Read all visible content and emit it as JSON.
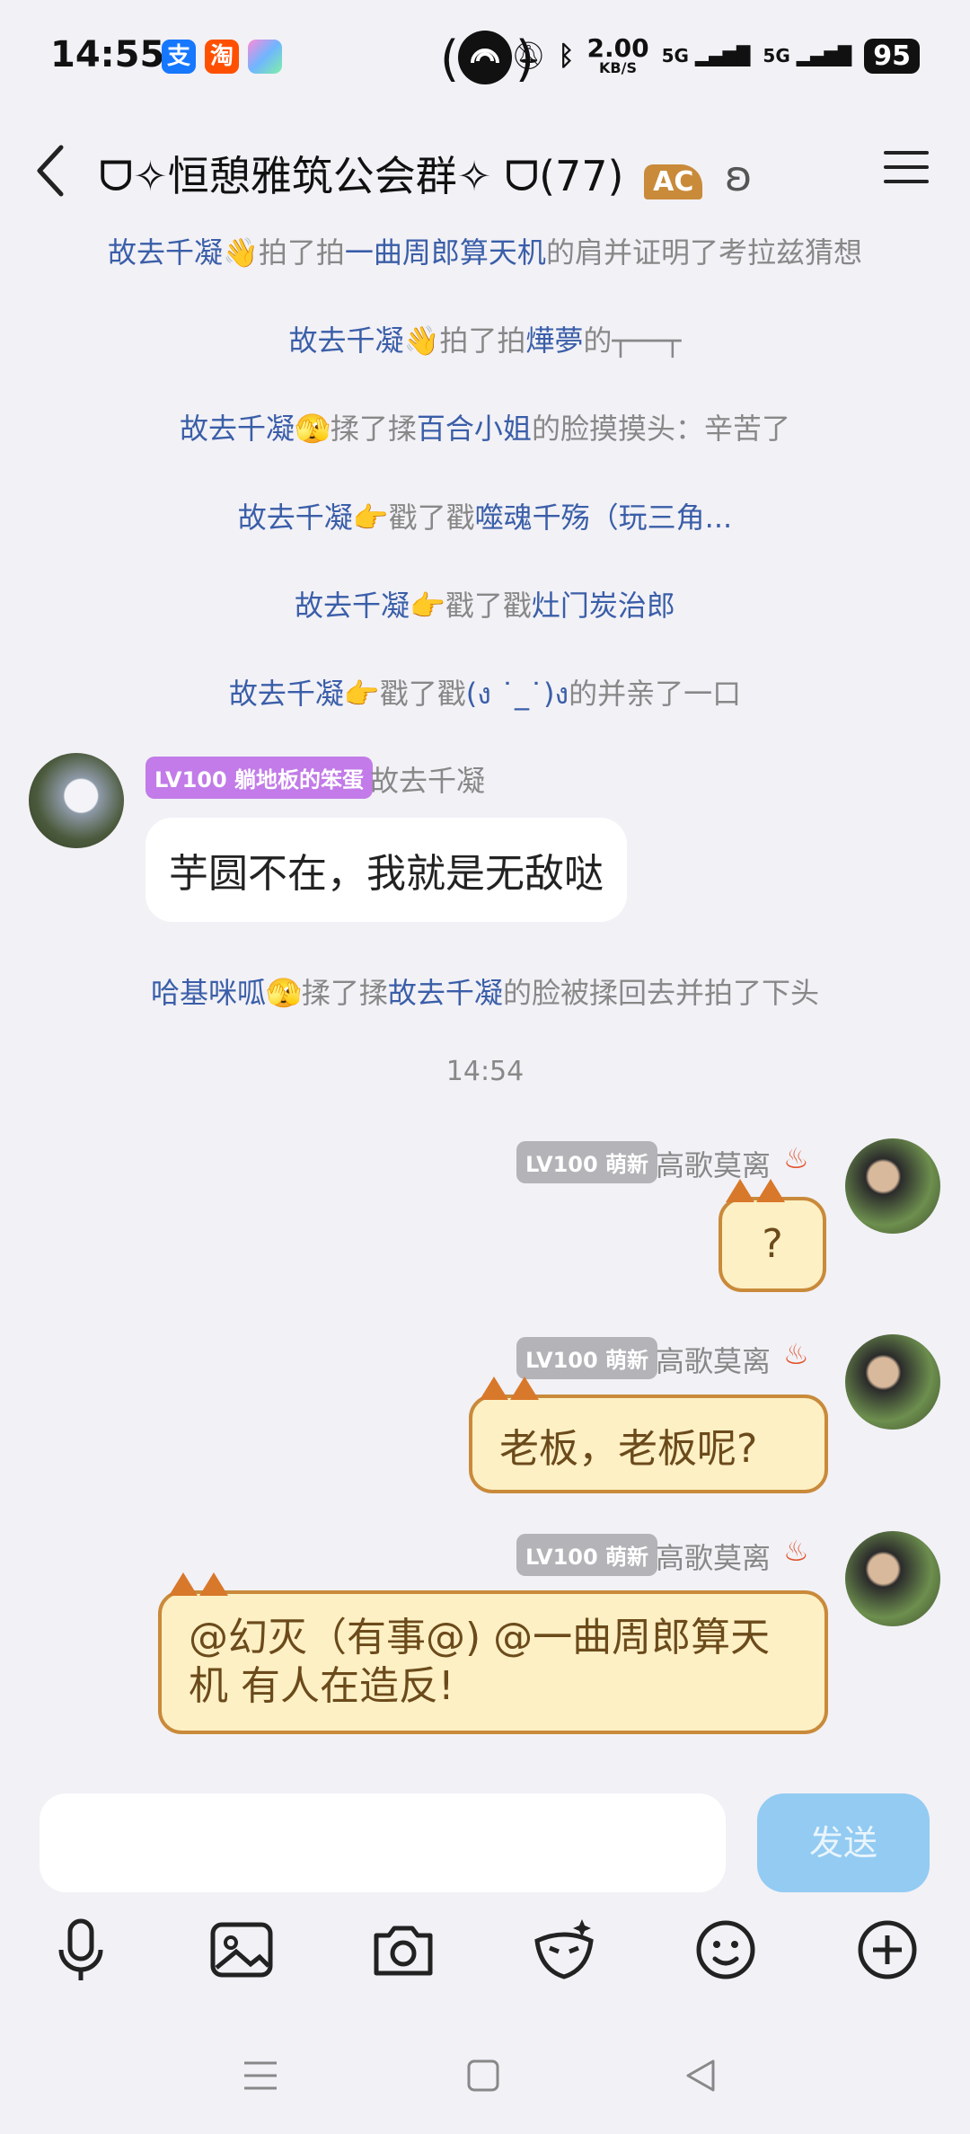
{
  "status_bar": {
    "time": "14:55",
    "app_icons": [
      {
        "name": "alipay-icon",
        "glyph": "支",
        "color": "#1677ff"
      },
      {
        "name": "taobao-icon",
        "glyph": "淘",
        "color": "#ff5000"
      },
      {
        "name": "app-gradient-icon",
        "glyph": "",
        "color": "#6fb6ff"
      }
    ],
    "speed": "2.00",
    "speed_unit": "KB/S",
    "signal1": "5G",
    "signal2": "5G",
    "battery": "95"
  },
  "header": {
    "title": "ᗜ✧恒憩雅筑公会群✧ ᗜ(77)",
    "badge": "AC"
  },
  "notices": [
    {
      "a": "故去千凝",
      "emoji": "👋",
      "verb": "拍了拍",
      "b": "一曲周郎算天机",
      "rest": "的肩并证明了考拉兹猜想"
    },
    {
      "a": "故去千凝",
      "emoji": "👋",
      "verb": "拍了拍",
      "b": "燁夢",
      "rest": "的┬──┬"
    },
    {
      "a": "故去千凝",
      "emoji": "🫣",
      "verb": "揉了揉",
      "b": "百合小姐",
      "rest": "的脸摸摸头：辛苦了"
    },
    {
      "a": "故去千凝",
      "emoji": "👉",
      "verb": "戳了戳",
      "b": "噬魂千殇（玩三角...",
      "rest": ""
    },
    {
      "a": "故去千凝",
      "emoji": "👉",
      "verb": "戳了戳",
      "b": "灶门炭治郎",
      "rest": ""
    },
    {
      "a": "故去千凝",
      "emoji": "👉",
      "verb": "戳了戳",
      "b": "(ง ˙_˙)ง",
      "rest": "的并亲了一口"
    }
  ],
  "msg1": {
    "level": "LV100 躺地板的笨蛋",
    "level_color": "#c27be8",
    "sender": "故去千凝",
    "text": "芋圆不在，我就是无敌哒"
  },
  "notice7": {
    "a": "哈基咪呱",
    "emoji": "🫣",
    "verb": "揉了揉",
    "b": "故去千凝",
    "rest": "的脸被揉回去并拍了下头"
  },
  "timestamp": "14:54",
  "msgs_right": [
    {
      "level": "LV100 萌新",
      "sender": "高歌莫离",
      "text": "?"
    },
    {
      "level": "LV100 萌新",
      "sender": "高歌莫离",
      "text": "老板，老板呢?"
    },
    {
      "level": "LV100 萌新",
      "sender": "高歌莫离",
      "text": "@幻灭（有事@) @一曲周郎算天机 有人在造反!"
    }
  ],
  "level_gray": "#b3b3b8",
  "input": {
    "value": "",
    "placeholder": ""
  },
  "send_label": "发送",
  "toolbar": [
    "microphone-icon",
    "image-icon",
    "camera-icon",
    "sticker-icon",
    "emoji-icon",
    "plus-icon"
  ],
  "nav": [
    "recent-apps-icon",
    "home-icon",
    "back-nav-icon"
  ]
}
